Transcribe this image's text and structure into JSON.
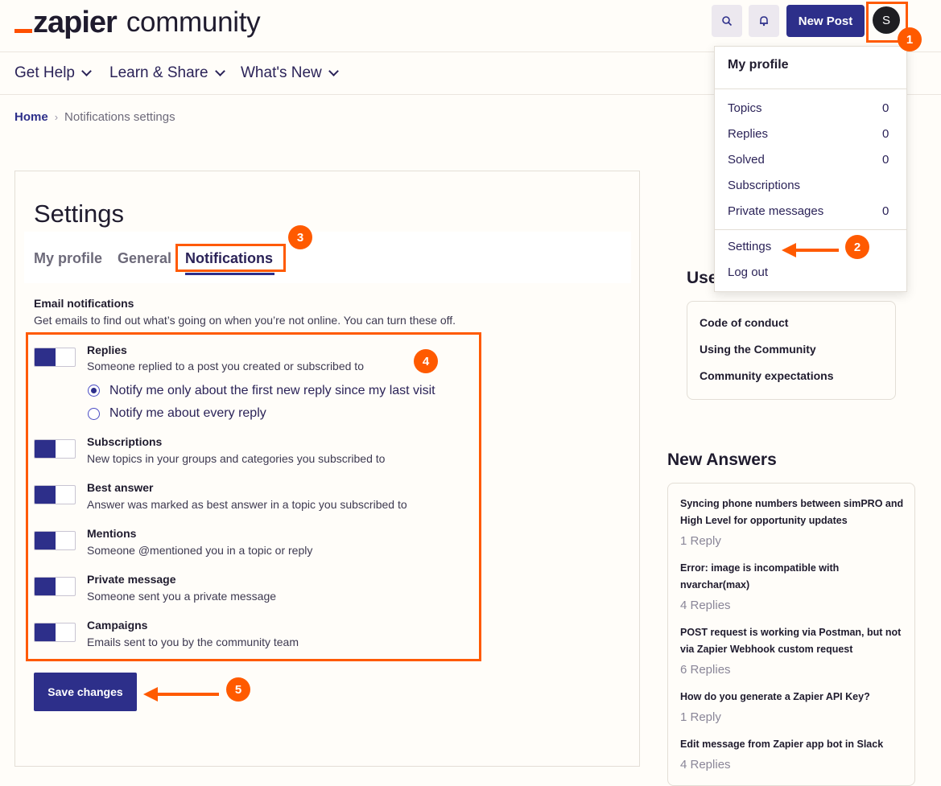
{
  "header": {
    "logo_word": "zapier",
    "logo_suffix": "community",
    "new_post_label": "New Post",
    "avatar_initial": "S",
    "icons": [
      "search-icon",
      "bell-icon"
    ]
  },
  "nav": {
    "items": [
      {
        "label": "Get Help"
      },
      {
        "label": "Learn & Share"
      },
      {
        "label": "What's New"
      }
    ]
  },
  "breadcrumb": {
    "home": "Home",
    "separator": "›",
    "current": "Notifications settings"
  },
  "settings": {
    "title": "Settings",
    "tabs": [
      {
        "label": "My profile"
      },
      {
        "label": "General"
      },
      {
        "label": "Notifications",
        "active": true
      }
    ],
    "email_heading": "Email notifications",
    "email_description": "Get emails to find out what’s going on when you’re not online. You can turn these off.",
    "toggles": [
      {
        "title": "Replies",
        "description": "Someone replied to a post you created or subscribed to",
        "on": true
      },
      {
        "title": "Subscriptions",
        "description": "New topics in your groups and categories you subscribed to",
        "on": true
      },
      {
        "title": "Best answer",
        "description": "Answer was marked as best answer in a topic you subscribed to",
        "on": true
      },
      {
        "title": "Mentions",
        "description": "Someone @mentioned you in a topic or reply",
        "on": true
      },
      {
        "title": "Private message",
        "description": "Someone sent you a private message",
        "on": true
      },
      {
        "title": "Campaigns",
        "description": "Emails sent to you by the community team",
        "on": true
      }
    ],
    "reply_options": [
      {
        "label": "Notify me only about the first new reply since my last visit",
        "selected": true
      },
      {
        "label": "Notify me about every reply",
        "selected": false
      }
    ],
    "save_label": "Save changes"
  },
  "sidebar": {
    "useful_heading": "Use",
    "useful_links": [
      {
        "label": "Code of conduct"
      },
      {
        "label": "Using the Community"
      },
      {
        "label": "Community expectations"
      }
    ],
    "new_answers_heading": "New Answers",
    "new_answers": [
      {
        "title": "Syncing phone numbers between simPRO and High Level for opportunity updates",
        "replies": "1 Reply"
      },
      {
        "title": "Error: image is incompatible with nvarchar(max)",
        "replies": "4 Replies"
      },
      {
        "title": "POST request is working via Postman, but not via Zapier Webhook custom request",
        "replies": "6 Replies"
      },
      {
        "title": "How do you generate a Zapier API Key?",
        "replies": "1 Reply"
      },
      {
        "title": "Edit message from Zapier app bot in Slack",
        "replies": "4 Replies"
      }
    ]
  },
  "dropdown": {
    "profile_label": "My profile",
    "stats": [
      {
        "label": "Topics",
        "count": "0"
      },
      {
        "label": "Replies",
        "count": "0"
      },
      {
        "label": "Solved",
        "count": "0"
      },
      {
        "label": "Subscriptions",
        "count": ""
      },
      {
        "label": "Private messages",
        "count": "0"
      }
    ],
    "settings_label": "Settings",
    "logout_label": "Log out"
  },
  "annotations": {
    "badges": [
      "1",
      "2",
      "3",
      "4",
      "5"
    ],
    "color": "#ff5a00"
  },
  "colors": {
    "brand_orange": "#ff4f00",
    "primary": "#2d2f8a",
    "background": "#fffdf9"
  }
}
